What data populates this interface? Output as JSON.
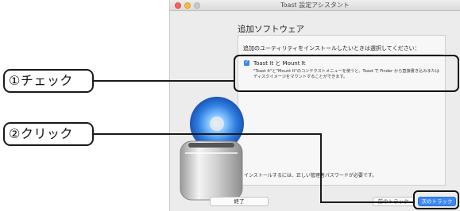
{
  "window": {
    "title": "Toast 設定アシスタント"
  },
  "section": {
    "title": "追加ソフトウェア"
  },
  "content": {
    "instruction": "追加のユーティリティをインストールしたいときは選択してください：",
    "option": {
      "label": "Toast It と Mount It",
      "checked": true,
      "description": "\"Toast It\"と\"Mount It\"のコンテクストメニューを使うと、Toast で Finder から直接書き込みまたはディスクイメージをマウントすることができます。"
    },
    "password_note": "インストールするには、正しい管理者パスワードが必要です。"
  },
  "buttons": {
    "quit": "終了",
    "back": "前のトラック",
    "next": "次のトラック"
  },
  "callouts": {
    "check": "①チェック",
    "click": "②クリック"
  },
  "colors": {
    "accent": "#3b88f5",
    "callout_border": "#1a1a1a"
  }
}
